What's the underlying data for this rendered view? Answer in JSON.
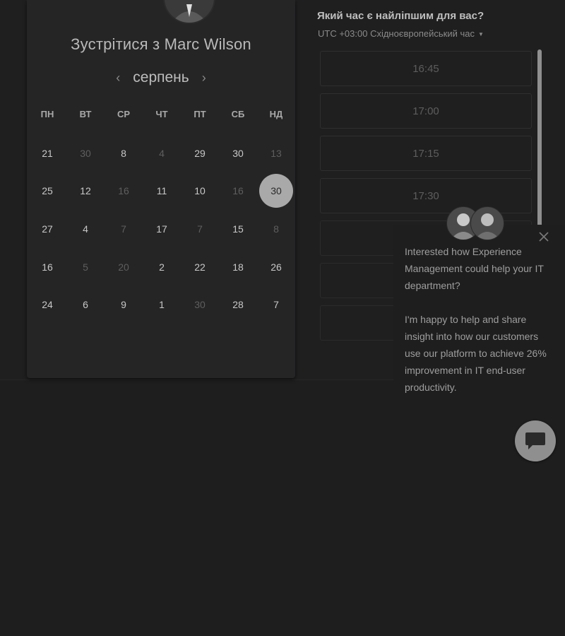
{
  "calendar": {
    "title": "Зустрітися з Marc Wilson",
    "month": "серпень",
    "weekdays": [
      "ПН",
      "ВТ",
      "СР",
      "ЧТ",
      "ПТ",
      "СБ",
      "НД"
    ],
    "days": [
      [
        "21",
        "30",
        "8",
        "4",
        "29",
        "30",
        "13"
      ],
      [
        "25",
        "12",
        "16",
        "11",
        "10",
        "16",
        "30"
      ],
      [
        "27",
        "4",
        "7",
        "17",
        "7",
        "15",
        "8"
      ],
      [
        "16",
        "5",
        "20",
        "2",
        "22",
        "18",
        "26"
      ],
      [
        "24",
        "6",
        "9",
        "1",
        "30",
        "28",
        "7"
      ]
    ],
    "selected_day": "30"
  },
  "times": {
    "heading": "Який час є найліпшим для вас?",
    "timezone": "UTC +03:00 Східноєвропейський час",
    "slots": [
      "16:45",
      "17:00",
      "17:15",
      "17:30"
    ]
  },
  "chat": {
    "message_1": "Interested how Experience Management could help your IT department?",
    "message_2": "I'm happy to help and share insight into how our customers use our platform to achieve 26% improvement in IT end-user productivity."
  },
  "icons": {
    "prev": "chevron-left-icon",
    "next": "chevron-right-icon",
    "close": "close-icon",
    "chat": "chat-bubble-icon",
    "caret": "caret-down-icon"
  }
}
